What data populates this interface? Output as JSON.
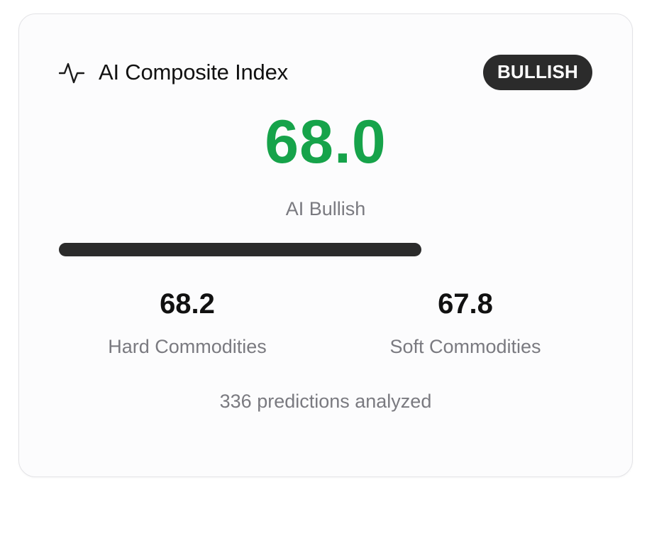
{
  "card": {
    "title": "AI Composite Index",
    "title_icon": "activity-pulse-icon",
    "badge": "BULLISH",
    "score": "68.0",
    "score_label": "AI Bullish",
    "progress_percent": 68,
    "hard": {
      "value": "68.2",
      "label": "Hard Commodities"
    },
    "soft": {
      "value": "67.8",
      "label": "Soft Commodities"
    },
    "footer": "336 predictions analyzed"
  },
  "colors": {
    "score": "#16a34a",
    "badge_bg": "#2b2b2b",
    "bar": "#2b2b2b",
    "muted_text": "#7a7a80"
  }
}
